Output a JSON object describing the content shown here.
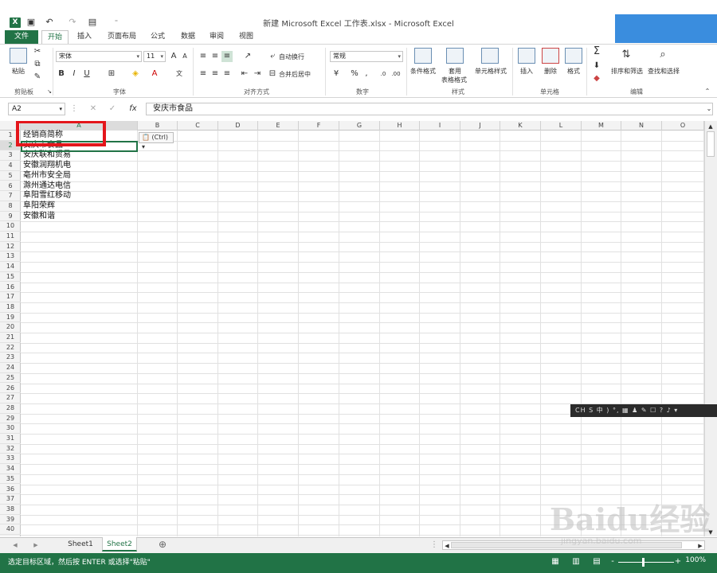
{
  "window": {
    "title": "新建 Microsoft Excel 工作表.xlsx - Microsoft Excel",
    "app_icon": "X"
  },
  "quick_access": {
    "save_icon": "save-icon",
    "undo_icon": "undo-icon",
    "redo_icon": "redo-icon",
    "touch_icon": "touch-mode-icon",
    "custom_icon": "customize-icon"
  },
  "tabs": {
    "file": "文件",
    "items": [
      "开始",
      "插入",
      "页面布局",
      "公式",
      "数据",
      "审阅",
      "视图"
    ],
    "active": "开始"
  },
  "ribbon": {
    "clipboard": {
      "paste": "粘贴",
      "label": "剪贴板"
    },
    "font": {
      "name": "宋体",
      "size": "11",
      "bold": "B",
      "italic": "I",
      "underline": "U",
      "grow": "A",
      "shrink": "A",
      "label": "字体"
    },
    "alignment": {
      "wrap": "自动换行",
      "merge": "合并后居中",
      "label": "对齐方式"
    },
    "number": {
      "format": "常规",
      "percent": "%",
      "comma": ",",
      "label": "数字"
    },
    "styles": {
      "cond": "条件格式",
      "table1": "套用",
      "table2": "表格格式",
      "cell": "单元格样式",
      "label": "样式"
    },
    "cells": {
      "insert": "插入",
      "delete": "删除",
      "format": "格式",
      "label": "单元格"
    },
    "editing": {
      "sum": "Σ",
      "sort": "排序和筛选",
      "find": "查找和选择",
      "label": "编辑"
    }
  },
  "formula_bar": {
    "name_box": "A2",
    "cancel": "✕",
    "enter": "✓",
    "fx": "fx",
    "value": "安庆市食品"
  },
  "columns": [
    "A",
    "B",
    "C",
    "D",
    "E",
    "F",
    "G",
    "H",
    "I",
    "J",
    "K",
    "L",
    "M",
    "N",
    "O"
  ],
  "rows": [
    "1",
    "2",
    "3",
    "4",
    "5",
    "6",
    "7",
    "8",
    "9",
    "10",
    "11",
    "12",
    "13",
    "14",
    "15",
    "16",
    "17",
    "18",
    "19",
    "20",
    "21",
    "22",
    "23",
    "24",
    "25",
    "26",
    "27",
    "28",
    "29",
    "30",
    "31",
    "32",
    "33",
    "34",
    "35",
    "36",
    "37",
    "38",
    "39",
    "40"
  ],
  "cells_A": [
    "经销商简称",
    "安庆市食品",
    "安庆联和贸易",
    "安徽润翔机电",
    "亳州市安全局",
    "滁州通达电信",
    "阜阳雪红移动",
    "阜阳荣辉",
    "安徽和谐"
  ],
  "paste_options": "(Ctrl)",
  "sheets": {
    "items": [
      "Sheet1",
      "Sheet2"
    ],
    "active": "Sheet2",
    "add": "⊕"
  },
  "status": {
    "text": "选定目标区域，然后按 ENTER 或选择\"粘贴\"",
    "zoom": "100%",
    "minus": "-",
    "plus": "+"
  },
  "ime_bar": "CH S 中 ) °, ▦ ♟ ✎ ☐ ? ♪ ▾",
  "watermark": {
    "main": "Baidu经验",
    "sub": "jingyan.baidu.com"
  }
}
